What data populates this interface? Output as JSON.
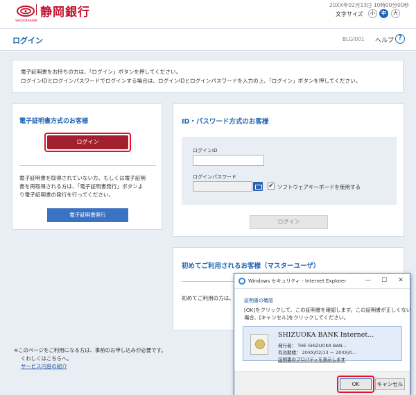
{
  "header": {
    "bank_name": "静岡銀行",
    "logo_subtext": "SHIZUOKABANK",
    "datetime": "20XX年02月13日 10時00分00秒",
    "font_size_label": "文字サイズ",
    "font_sizes": [
      "小",
      "中",
      "大"
    ]
  },
  "titlebar": {
    "title": "ログイン",
    "screen_id": "BLGI001",
    "help_label": "ヘルプ",
    "help_icon": "?"
  },
  "info": {
    "line1": "電子証明書をお持ちの方は、「ログイン」ボタンを押してください。",
    "line2": "ログインIDとログインパスワードでログインする場合は、ログインIDとログインパスワードを入力の上、「ログイン」ボタンを押してください。"
  },
  "cert_section": {
    "title": "電子証明書方式のお客様",
    "login_button": "ログイン",
    "text_line1": "電子証明書を取得されていない方、もしくは電子証明",
    "text_line2": "書を再取得される方は、「電子証明書発行」ボタンよ",
    "text_line3": "り電子証明書の発行を行ってください。",
    "issue_button": "電子証明書発行"
  },
  "id_section": {
    "title": "ID・パスワード方式のお客様",
    "id_label": "ログインID",
    "id_value": "",
    "password_label": "ログインパスワード",
    "password_value": "",
    "keyboard_check": "✔",
    "keyboard_label": "ソフトウェアキーボードを使用する",
    "login_button": "ログイン"
  },
  "master_section": {
    "title": "初めてご利用されるお客様（マスターユーザ）",
    "text": "初めてご利用の方は、"
  },
  "notes": {
    "line1": "※このページをご利用になる方は、事前のお申し込みが必要です。",
    "line2": "くわしくはこちらへ。",
    "link": "サービス内容の紹介"
  },
  "dialog": {
    "title": "Windows セキュリティ - Internet Explorer",
    "minimize": "—",
    "maximize": "☐",
    "close": "✕",
    "heading": "証明書の確認",
    "text_line1": "[OK]をクリックして、この証明書を確認します。この証明書が正しくない",
    "text_line2": "場合、[キャンセル]をクリックしてください。",
    "cert_name": "SHIZUOKA BANK Internet...",
    "issuer": "発行者：  THE SHIZUOKA BAN...",
    "validity": "有効期間：  20XX/02/13 ～ 20XX/0...",
    "properties_link": "証明書のプロパティを表示します",
    "ok_button": "OK",
    "cancel_button": "キャンセル"
  },
  "colors": {
    "brand_red": "#c5122d",
    "accent_blue": "#1f64b3",
    "highlight_red": "#e8102b"
  }
}
